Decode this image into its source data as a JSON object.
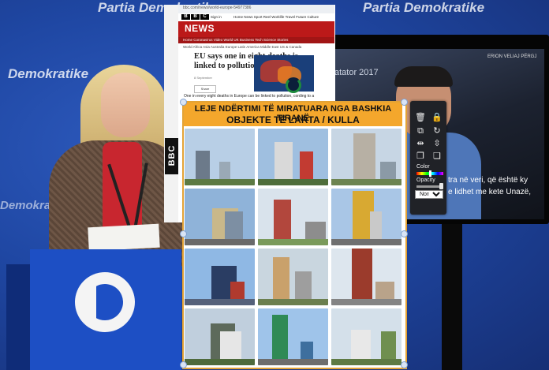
{
  "background": {
    "brand_lines": [
      "Partia Demokratike",
      "Partia Demokratike",
      "Demokratike",
      "Demokratike"
    ],
    "monitor": {
      "top_caption": "ERION VELIAJ PËRGJ",
      "mid_caption": "atator 2017",
      "subtitle_line1": "tra në veri, që është ky",
      "subtitle_line2": "e lidhet me kete Unazë,"
    }
  },
  "bbc_overlay": {
    "url": "bbc.com/news/world-europe-54977386",
    "logo": "BBC",
    "sign_in": "Sign in",
    "top_nav": "Home   News   Sport   Reel   Worklife   Travel   Future   Culture",
    "section": "NEWS",
    "section_nav": "Home   Coronavirus   Video   World   UK   Business   Tech   Science   Stories",
    "sub_nav": "World   Africa   Asia   Australia   Europe   Latin America   Middle East   US & Canada",
    "headline": "EU says one in eight deaths is linked to pollution",
    "timestamp": "8 September",
    "share_label": "Share",
    "body_text": "One in every eight deaths in Europe can be linked to pollution,     cording to a",
    "side_logo": "BBC"
  },
  "poster": {
    "title_line1": "LEJE NDËRTIMI TË MIRATUARA NGA BASHKIA TIRANË",
    "title_line2": "OBJEKTE TË LARTA / KULLA",
    "tiles": [
      {
        "sky": "#b8cfe6",
        "c1": "#6c7a8a",
        "c2": "#9aa9b6",
        "ground": "#5d7a43"
      },
      {
        "sky": "#9fbfe0",
        "c1": "#d9d9d9",
        "c2": "#c23b32",
        "ground": "#4f6e3b"
      },
      {
        "sky": "#c7d6e4",
        "c1": "#b7b0a4",
        "c2": "#8b9aa6",
        "ground": "#6d8450"
      },
      {
        "sky": "#8fb3d9",
        "c1": "#c9b88a",
        "c2": "#7d8fa3",
        "ground": "#6a6a6a"
      },
      {
        "sky": "#d9e3ec",
        "c1": "#b2473d",
        "c2": "#8d8d8d",
        "ground": "#7a9a5b"
      },
      {
        "sky": "#a9c6e6",
        "c1": "#d8a932",
        "c2": "#c9c9c9",
        "ground": "#707070"
      },
      {
        "sky": "#8fb8e4",
        "c1": "#2a3d63",
        "c2": "#b03a2e",
        "ground": "#55617a"
      },
      {
        "sky": "#c9d6df",
        "c1": "#c9a16b",
        "c2": "#9e9e9e",
        "ground": "#6b7f4f"
      },
      {
        "sky": "#dde6ee",
        "c1": "#9b3b2c",
        "c2": "#b9a38a",
        "ground": "#848484"
      },
      {
        "sky": "#c0cfdd",
        "c1": "#5d6a5b",
        "c2": "#e6e6e6",
        "ground": "#4e6a3c"
      },
      {
        "sky": "#9fc4ea",
        "c1": "#2f8a55",
        "c2": "#3e6f9e",
        "ground": "#6d6d6d"
      },
      {
        "sky": "#d4e0ea",
        "c1": "#e8e8e8",
        "c2": "#6f8f4f",
        "ground": "#5e7a44"
      }
    ]
  },
  "toolbar": {
    "icons": {
      "delete": "trash-icon",
      "lock": "lock-icon",
      "duplicate": "copy-icon",
      "rotate": "rotate-icon",
      "flip_horizontal": "flip-horizontal-icon",
      "flip_vertical": "flip-vertical-icon",
      "bring_forward": "bring-forward-icon",
      "send_backward": "send-backward-icon"
    },
    "color_label": "Color",
    "opacity_label": "Opacity",
    "opacity_value": 0.95,
    "blend_mode": "Normal"
  }
}
